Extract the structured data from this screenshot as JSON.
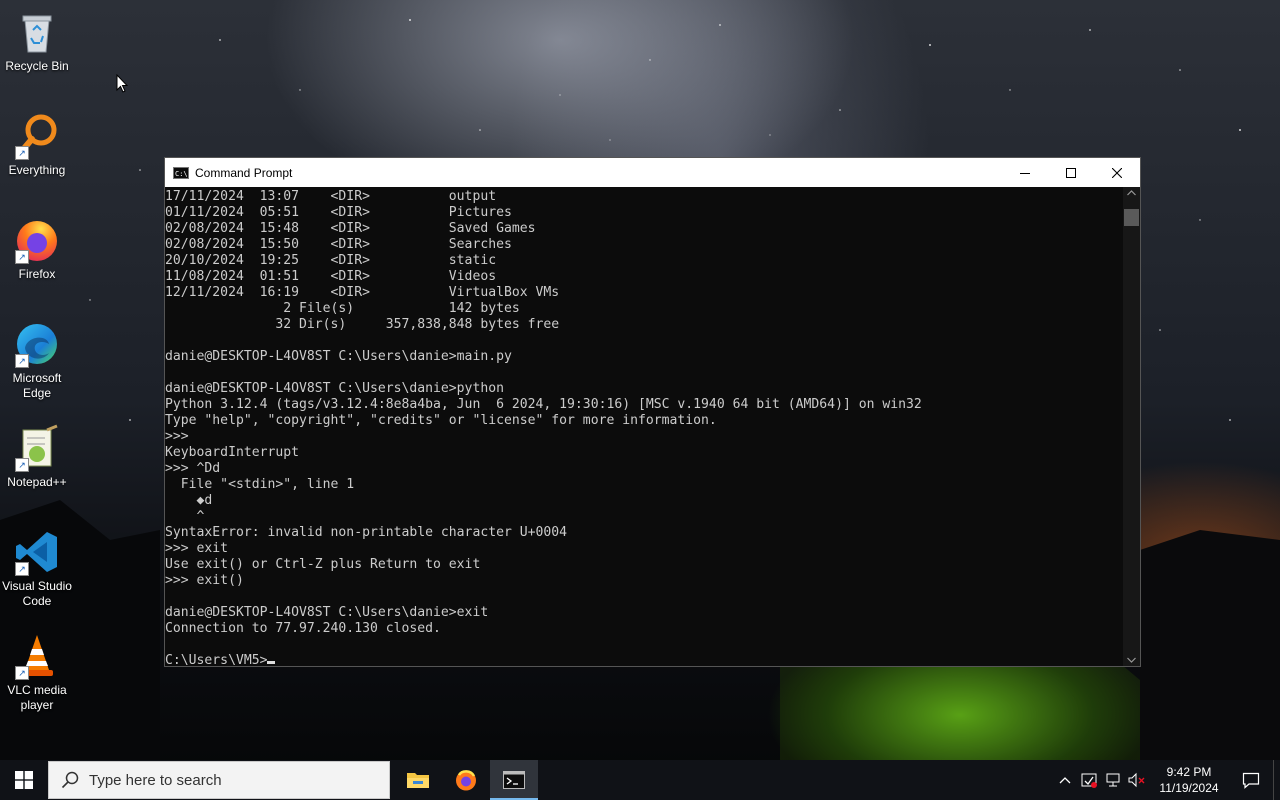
{
  "desktop": {
    "icons": [
      {
        "label": "Recycle Bin"
      },
      {
        "label": "Everything"
      },
      {
        "label": "Firefox"
      },
      {
        "label": "Microsoft Edge"
      },
      {
        "label": "Notepad++"
      },
      {
        "label": "Visual Studio Code"
      },
      {
        "label": "VLC media player"
      }
    ]
  },
  "window": {
    "title": "Command Prompt",
    "icon_text": "C:\\.",
    "console_lines": [
      "17/11/2024  13:07    <DIR>          output",
      "01/11/2024  05:51    <DIR>          Pictures",
      "02/08/2024  15:48    <DIR>          Saved Games",
      "02/08/2024  15:50    <DIR>          Searches",
      "20/10/2024  19:25    <DIR>          static",
      "11/08/2024  01:51    <DIR>          Videos",
      "12/11/2024  16:19    <DIR>          VirtualBox VMs",
      "               2 File(s)            142 bytes",
      "              32 Dir(s)     357,838,848 bytes free",
      "",
      "danie@DESKTOP-L4OV8ST C:\\Users\\danie>main.py",
      "",
      "danie@DESKTOP-L4OV8ST C:\\Users\\danie>python",
      "Python 3.12.4 (tags/v3.12.4:8e8a4ba, Jun  6 2024, 19:30:16) [MSC v.1940 64 bit (AMD64)] on win32",
      "Type \"help\", \"copyright\", \"credits\" or \"license\" for more information.",
      ">>>",
      "KeyboardInterrupt",
      ">>> ^Dd",
      "  File \"<stdin>\", line 1",
      "    ◆d",
      "    ^",
      "SyntaxError: invalid non-printable character U+0004",
      ">>> exit",
      "Use exit() or Ctrl-Z plus Return to exit",
      ">>> exit()",
      "",
      "danie@DESKTOP-L4OV8ST C:\\Users\\danie>exit",
      "Connection to 77.97.240.130 closed.",
      ""
    ],
    "prompt": "C:\\Users\\VM5>"
  },
  "taskbar": {
    "search_placeholder": "Type here to search",
    "clock_time": "9:42 PM",
    "clock_date": "11/19/2024"
  }
}
